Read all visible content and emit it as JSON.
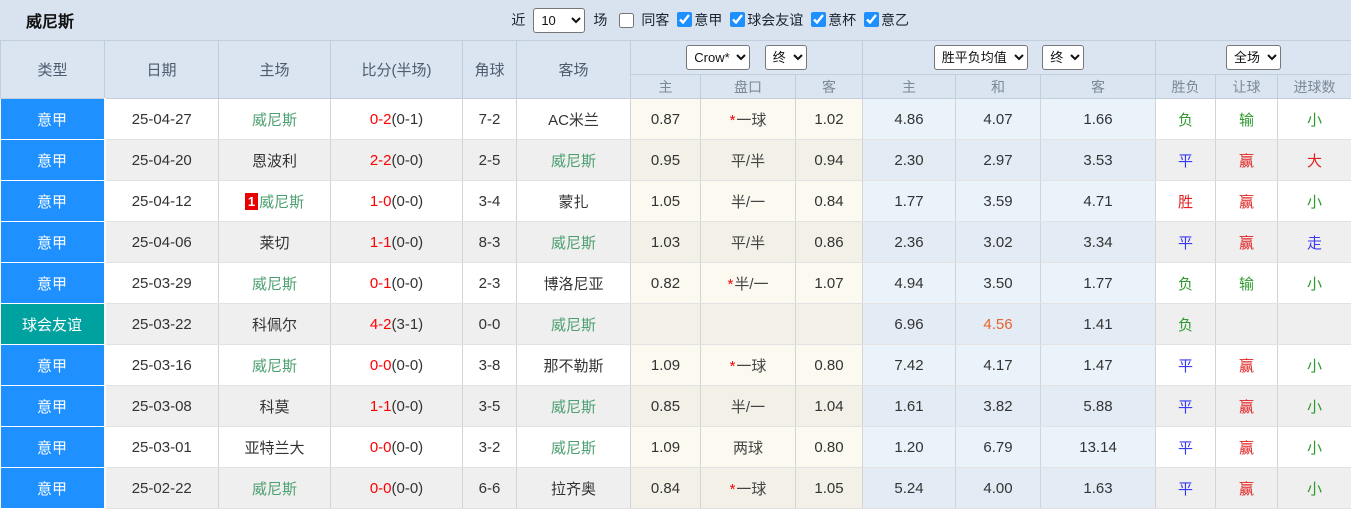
{
  "palette": {
    "league_primary": "#1E90FF",
    "league_friendly": "#00A2A0",
    "team_green": "#4C9F6F",
    "score_red": "#FF0000",
    "hot_orange": "#E8622D",
    "win_red": "#E02020",
    "draw_blue": "#3A3AF0",
    "loss_green": "#2E9A2E"
  },
  "topbar": {
    "team": "威尼斯",
    "recent_label": "近",
    "recent_value": "10",
    "matches_label": "场",
    "same_opponent_label": "同客",
    "same_opponent_checked": false,
    "leagues": [
      {
        "label": "意甲",
        "checked": true
      },
      {
        "label": "球会友谊",
        "checked": true
      },
      {
        "label": "意杯",
        "checked": true
      },
      {
        "label": "意乙",
        "checked": true
      }
    ]
  },
  "header": {
    "columns": [
      "类型",
      "日期",
      "主场",
      "比分(半场)",
      "角球",
      "客场"
    ],
    "odds_group": {
      "select_provider": "Crow*",
      "select_stage": "终",
      "sub": [
        "主",
        "盘口",
        "客"
      ]
    },
    "mean_group": {
      "select_type": "胜平负均值",
      "select_stage": "终",
      "sub": [
        "主",
        "和",
        "客"
      ]
    },
    "result_group": {
      "select_scope": "全场",
      "sub": [
        "胜负",
        "让球",
        "进球数"
      ]
    }
  },
  "result_color_map": {
    "胜": "win",
    "赢": "win",
    "大": "win",
    "平": "draw",
    "走": "draw",
    "负": "loss",
    "输": "loss",
    "小": "loss"
  },
  "table": {
    "rows": [
      {
        "league": "意甲",
        "league_kind": "primary",
        "date": "25-04-27",
        "home": "威尼斯",
        "home_self": true,
        "badge": null,
        "score": "0-2",
        "half": "(0-1)",
        "corners": "7-2",
        "away": "AC米兰",
        "away_self": false,
        "crow": {
          "home": "0.87",
          "line": "一球",
          "star": true,
          "away": "1.02"
        },
        "mean": {
          "home": "4.86",
          "draw": "4.07",
          "away": "1.66",
          "draw_hot": false
        },
        "result": {
          "wdl": "负",
          "handicap": "输",
          "goals": "小"
        }
      },
      {
        "league": "意甲",
        "league_kind": "primary",
        "date": "25-04-20",
        "home": "恩波利",
        "home_self": false,
        "badge": null,
        "score": "2-2",
        "half": "(0-0)",
        "corners": "2-5",
        "away": "威尼斯",
        "away_self": true,
        "crow": {
          "home": "0.95",
          "line": "平/半",
          "star": false,
          "away": "0.94"
        },
        "mean": {
          "home": "2.30",
          "draw": "2.97",
          "away": "3.53",
          "draw_hot": false
        },
        "result": {
          "wdl": "平",
          "handicap": "赢",
          "goals": "大"
        }
      },
      {
        "league": "意甲",
        "league_kind": "primary",
        "date": "25-04-12",
        "home": "威尼斯",
        "home_self": true,
        "badge": "1",
        "score": "1-0",
        "half": "(0-0)",
        "corners": "3-4",
        "away": "蒙扎",
        "away_self": false,
        "crow": {
          "home": "1.05",
          "line": "半/一",
          "star": false,
          "away": "0.84"
        },
        "mean": {
          "home": "1.77",
          "draw": "3.59",
          "away": "4.71",
          "draw_hot": false
        },
        "result": {
          "wdl": "胜",
          "handicap": "赢",
          "goals": "小"
        }
      },
      {
        "league": "意甲",
        "league_kind": "primary",
        "date": "25-04-06",
        "home": "莱切",
        "home_self": false,
        "badge": null,
        "score": "1-1",
        "half": "(0-0)",
        "corners": "8-3",
        "away": "威尼斯",
        "away_self": true,
        "crow": {
          "home": "1.03",
          "line": "平/半",
          "star": false,
          "away": "0.86"
        },
        "mean": {
          "home": "2.36",
          "draw": "3.02",
          "away": "3.34",
          "draw_hot": false
        },
        "result": {
          "wdl": "平",
          "handicap": "赢",
          "goals": "走"
        }
      },
      {
        "league": "意甲",
        "league_kind": "primary",
        "date": "25-03-29",
        "home": "威尼斯",
        "home_self": true,
        "badge": null,
        "score": "0-1",
        "half": "(0-0)",
        "corners": "2-3",
        "away": "博洛尼亚",
        "away_self": false,
        "crow": {
          "home": "0.82",
          "line": "半/一",
          "star": true,
          "away": "1.07"
        },
        "mean": {
          "home": "4.94",
          "draw": "3.50",
          "away": "1.77",
          "draw_hot": false
        },
        "result": {
          "wdl": "负",
          "handicap": "输",
          "goals": "小"
        }
      },
      {
        "league": "球会友谊",
        "league_kind": "friendly",
        "date": "25-03-22",
        "home": "科佩尔",
        "home_self": false,
        "badge": null,
        "score": "4-2",
        "half": "(3-1)",
        "corners": "0-0",
        "away": "威尼斯",
        "away_self": true,
        "crow": {
          "home": "",
          "line": "",
          "star": false,
          "away": ""
        },
        "mean": {
          "home": "6.96",
          "draw": "4.56",
          "away": "1.41",
          "draw_hot": true
        },
        "result": {
          "wdl": "负",
          "handicap": "",
          "goals": ""
        }
      },
      {
        "league": "意甲",
        "league_kind": "primary",
        "date": "25-03-16",
        "home": "威尼斯",
        "home_self": true,
        "badge": null,
        "score": "0-0",
        "half": "(0-0)",
        "corners": "3-8",
        "away": "那不勒斯",
        "away_self": false,
        "crow": {
          "home": "1.09",
          "line": "一球",
          "star": true,
          "away": "0.80"
        },
        "mean": {
          "home": "7.42",
          "draw": "4.17",
          "away": "1.47",
          "draw_hot": false
        },
        "result": {
          "wdl": "平",
          "handicap": "赢",
          "goals": "小"
        }
      },
      {
        "league": "意甲",
        "league_kind": "primary",
        "date": "25-03-08",
        "home": "科莫",
        "home_self": false,
        "badge": null,
        "score": "1-1",
        "half": "(0-0)",
        "corners": "3-5",
        "away": "威尼斯",
        "away_self": true,
        "crow": {
          "home": "0.85",
          "line": "半/一",
          "star": false,
          "away": "1.04"
        },
        "mean": {
          "home": "1.61",
          "draw": "3.82",
          "away": "5.88",
          "draw_hot": false
        },
        "result": {
          "wdl": "平",
          "handicap": "赢",
          "goals": "小"
        }
      },
      {
        "league": "意甲",
        "league_kind": "primary",
        "date": "25-03-01",
        "home": "亚特兰大",
        "home_self": false,
        "badge": null,
        "score": "0-0",
        "half": "(0-0)",
        "corners": "3-2",
        "away": "威尼斯",
        "away_self": true,
        "crow": {
          "home": "1.09",
          "line": "两球",
          "star": false,
          "away": "0.80"
        },
        "mean": {
          "home": "1.20",
          "draw": "6.79",
          "away": "13.14",
          "draw_hot": false
        },
        "result": {
          "wdl": "平",
          "handicap": "赢",
          "goals": "小"
        }
      },
      {
        "league": "意甲",
        "league_kind": "primary",
        "date": "25-02-22",
        "home": "威尼斯",
        "home_self": true,
        "badge": null,
        "score": "0-0",
        "half": "(0-0)",
        "corners": "6-6",
        "away": "拉齐奥",
        "away_self": false,
        "crow": {
          "home": "0.84",
          "line": "一球",
          "star": true,
          "away": "1.05"
        },
        "mean": {
          "home": "5.24",
          "draw": "4.00",
          "away": "1.63",
          "draw_hot": false
        },
        "result": {
          "wdl": "平",
          "handicap": "赢",
          "goals": "小"
        }
      }
    ]
  }
}
